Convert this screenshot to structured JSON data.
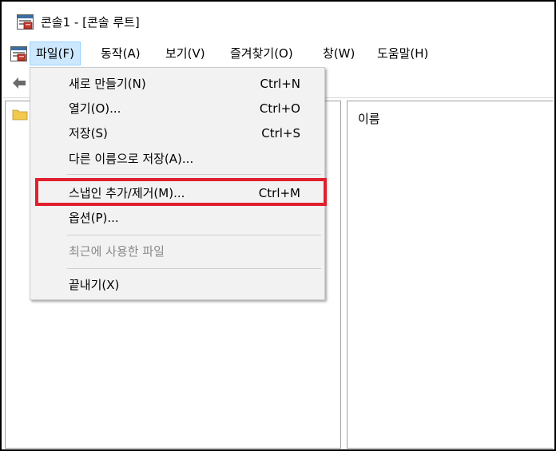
{
  "window": {
    "title": "콘솔1 - [콘솔 루트]",
    "app_icon": "mmc-console-icon"
  },
  "menubar": {
    "sys_icon": "mmc-console-icon",
    "items": [
      {
        "label": "파일(F)",
        "active": true
      },
      {
        "label": "동작(A)"
      },
      {
        "label": "보기(V)"
      },
      {
        "label": "즐겨찾기(O)"
      },
      {
        "label": "창(W)"
      },
      {
        "label": "도움말(H)"
      }
    ]
  },
  "toolbar": {
    "back_icon": "back-arrow-icon"
  },
  "left_pane": {
    "folder_icon": "folder-icon"
  },
  "right_pane": {
    "column_header": "이름"
  },
  "file_menu": {
    "items": [
      {
        "label": "새로 만들기(N)",
        "shortcut": "Ctrl+N"
      },
      {
        "label": "열기(O)...",
        "shortcut": "Ctrl+O"
      },
      {
        "label": "저장(S)",
        "shortcut": "Ctrl+S"
      },
      {
        "label": "다른 이름으로 저장(A)...",
        "shortcut": ""
      },
      {
        "label": "스냅인 추가/제거(M)...",
        "shortcut": "Ctrl+M",
        "highlighted": true
      },
      {
        "label": "옵션(P)...",
        "shortcut": ""
      },
      {
        "label": "최근에 사용한 파일",
        "shortcut": "",
        "disabled": true
      },
      {
        "label": "끝내기(X)",
        "shortcut": ""
      }
    ]
  },
  "colors": {
    "highlight_border": "#e0202c",
    "menu_active_bg": "#cce8ff",
    "menu_bg": "#f2f2f2"
  }
}
